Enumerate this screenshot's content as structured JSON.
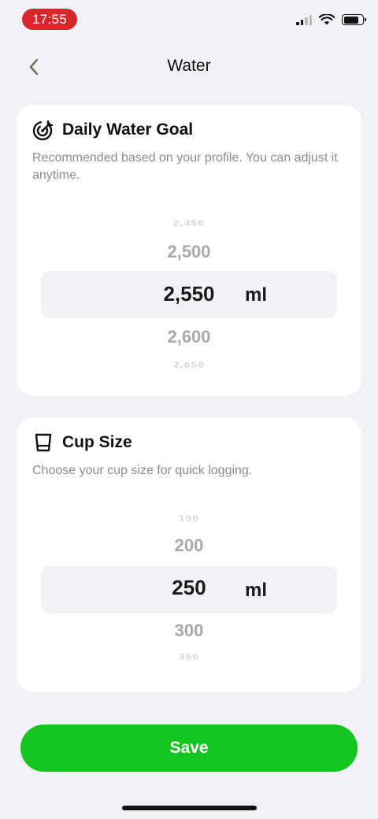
{
  "status_bar": {
    "time": "17:55",
    "icons": [
      "cellular-signal-icon",
      "wifi-icon",
      "battery-icon"
    ]
  },
  "nav": {
    "title": "Water",
    "back_icon": "chevron-left-icon"
  },
  "daily_goal": {
    "icon": "target-icon",
    "title": "Daily Water Goal",
    "description": "Recommended based on your profile. You can adjust it anytime.",
    "picker": {
      "options": [
        "2,450",
        "2,500",
        "2,550",
        "2,600",
        "2,650"
      ],
      "selected": "2,550",
      "unit": "ml"
    }
  },
  "cup_size": {
    "icon": "cup-icon",
    "title": "Cup Size",
    "description": "Choose your cup size for quick logging.",
    "picker": {
      "options": [
        "150",
        "200",
        "250",
        "300",
        "350"
      ],
      "selected": "250",
      "unit": "ml"
    }
  },
  "save_label": "Save",
  "colors": {
    "accent": "#15c51f",
    "time_pill": "#d7272d",
    "background": "#f2f1f6"
  }
}
